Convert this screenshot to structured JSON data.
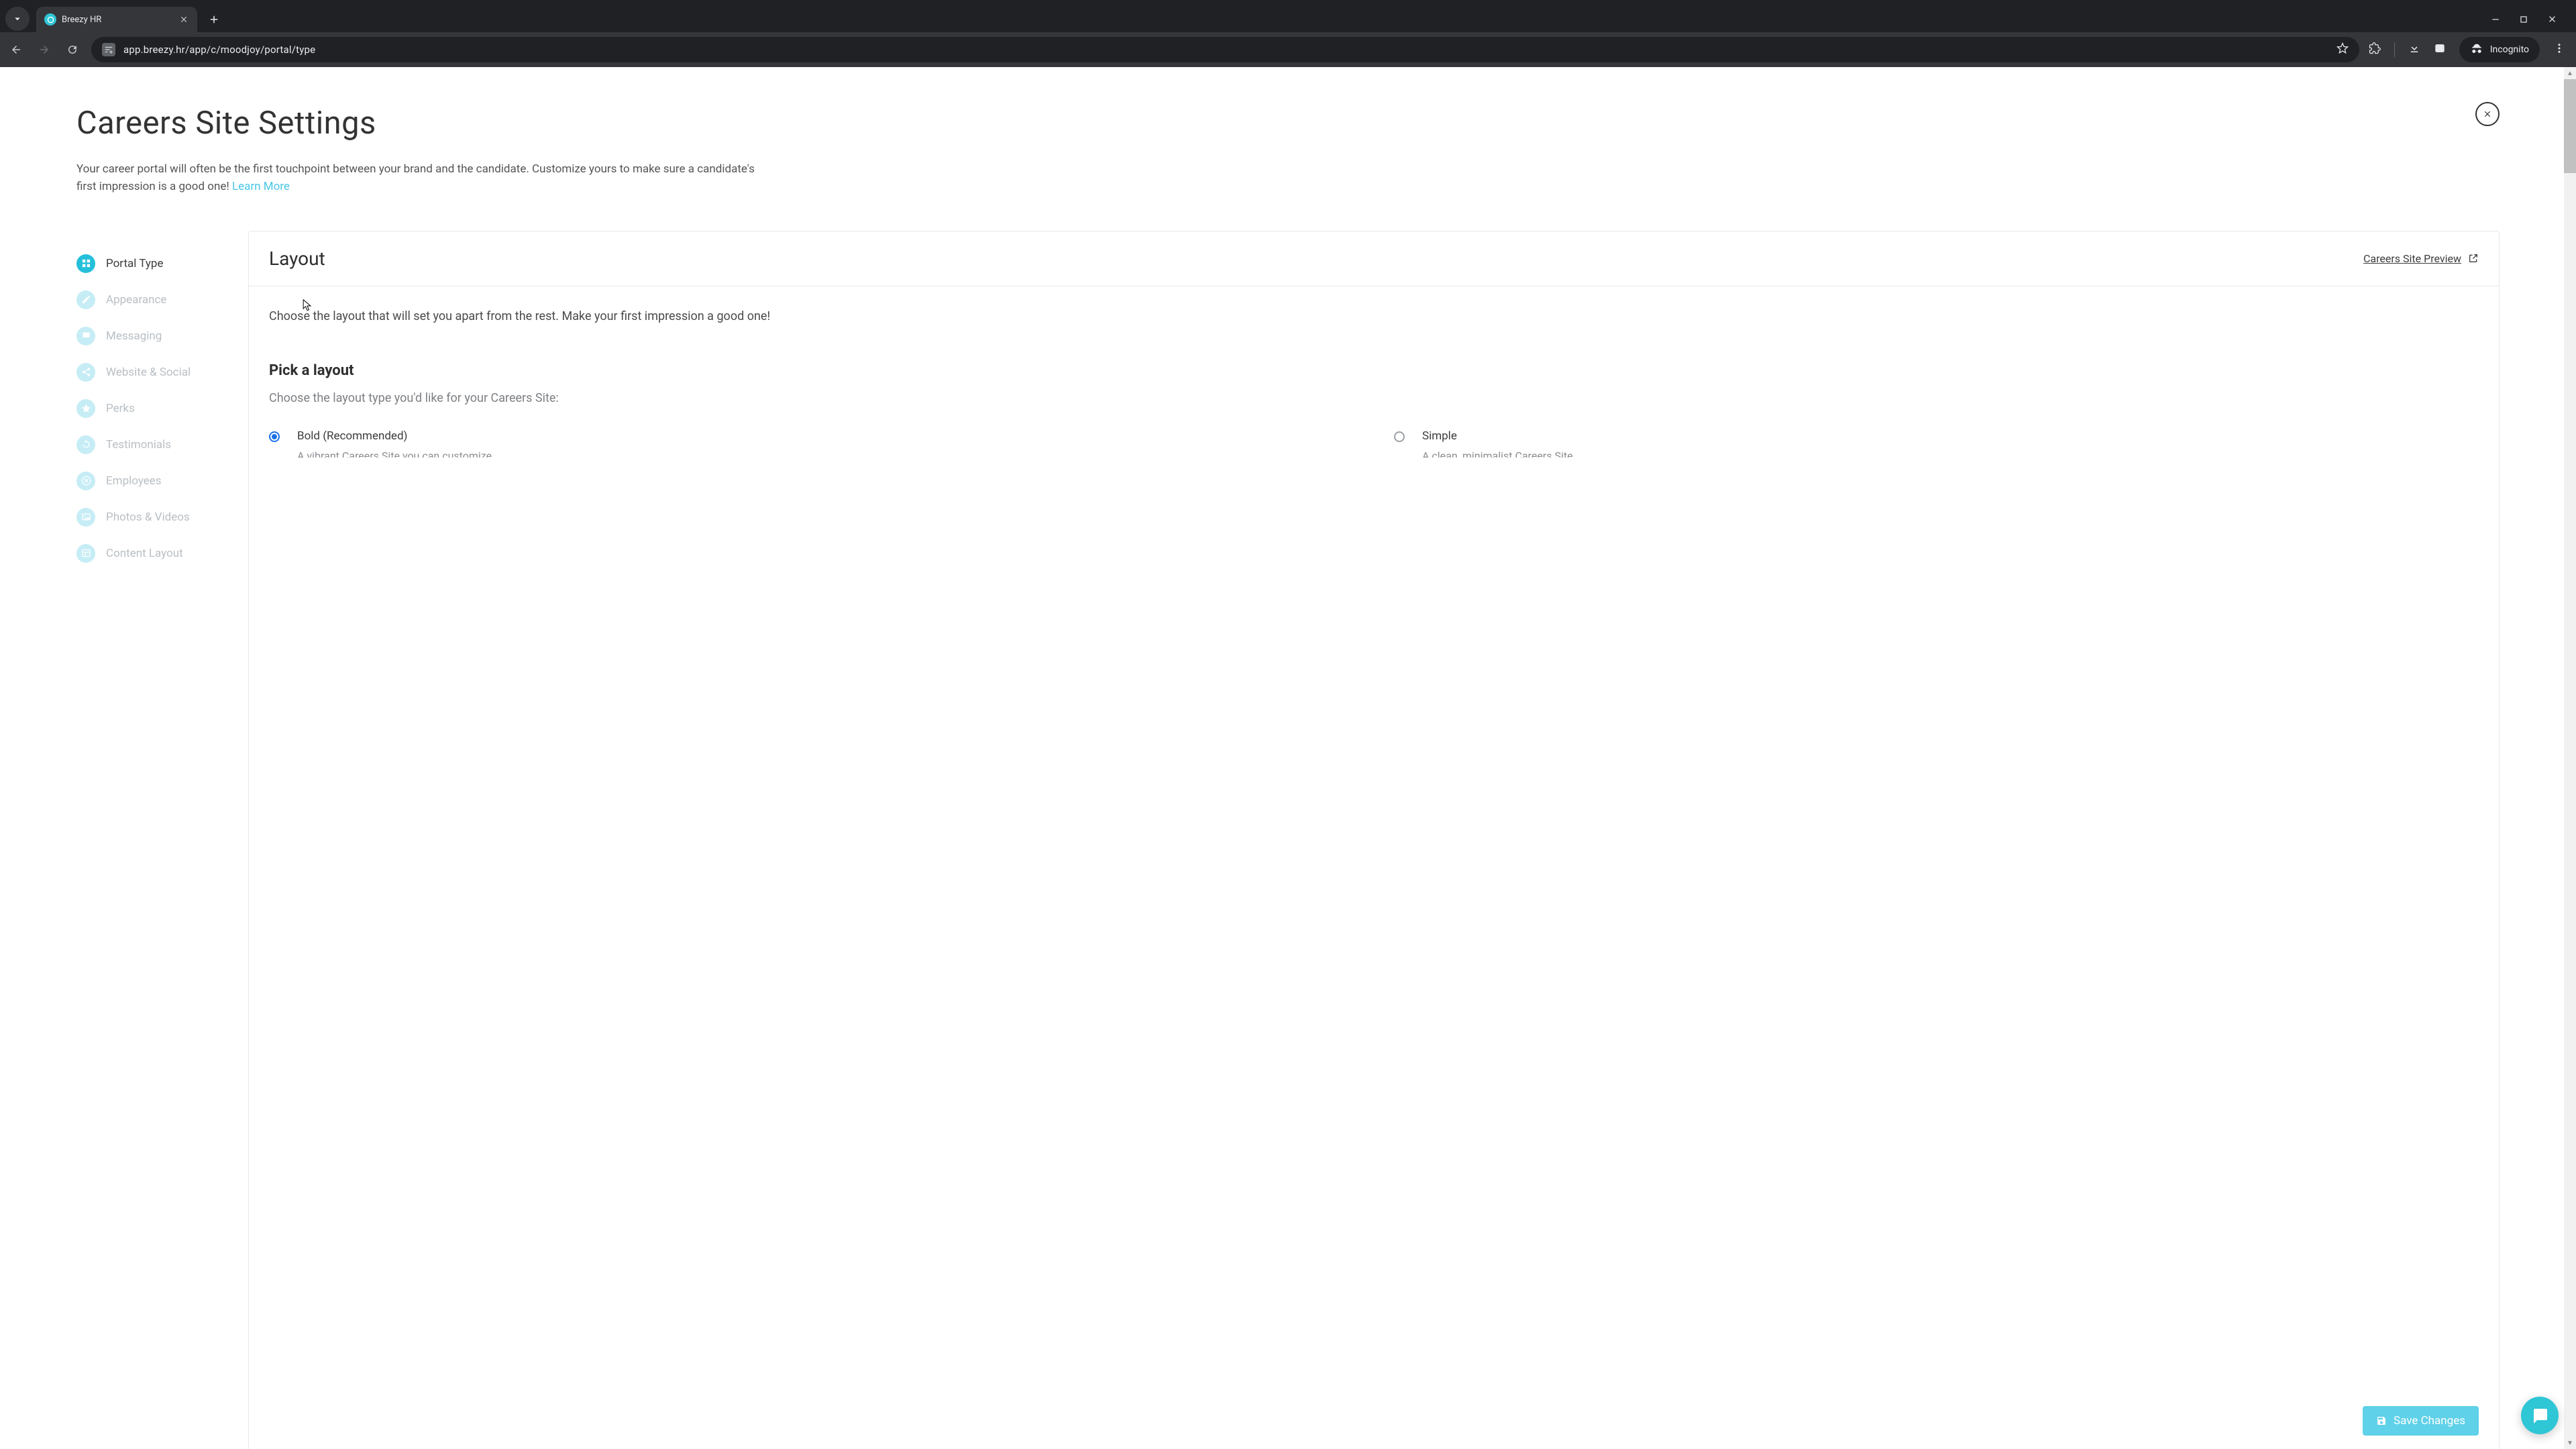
{
  "browser": {
    "tab_title": "Breezy HR",
    "url": "app.breezy.hr/app/c/moodjoy/portal/type",
    "incognito_label": "Incognito"
  },
  "page": {
    "title": "Careers Site Settings",
    "description": "Your career portal will often be the first touchpoint between your brand and the candidate. Customize yours to make sure a candidate's first impression is a good one! ",
    "learn_more": "Learn More"
  },
  "sidebar": {
    "items": [
      {
        "label": "Portal Type",
        "icon": "grid",
        "active": true
      },
      {
        "label": "Appearance",
        "icon": "pencil",
        "active": false
      },
      {
        "label": "Messaging",
        "icon": "message",
        "active": false
      },
      {
        "label": "Website & Social",
        "icon": "share",
        "active": false
      },
      {
        "label": "Perks",
        "icon": "star",
        "active": false
      },
      {
        "label": "Testimonials",
        "icon": "refresh",
        "active": false
      },
      {
        "label": "Employees",
        "icon": "close-circle",
        "active": false
      },
      {
        "label": "Photos & Videos",
        "icon": "image",
        "active": false
      },
      {
        "label": "Content Layout",
        "icon": "layout",
        "active": false
      }
    ]
  },
  "panel": {
    "header_title": "Layout",
    "preview_link": "Careers Site Preview",
    "lead": "Choose the layout that will set you apart from the rest. Make your first impression a good one!",
    "sub_title": "Pick a layout",
    "sub_desc": "Choose the layout type you'd like for your Careers Site:",
    "options": [
      {
        "label": "Bold (Recommended)",
        "desc": "A vibrant Careers Site you can customize",
        "checked": true
      },
      {
        "label": "Simple",
        "desc": "A clean, minimalist Careers Site",
        "checked": false
      }
    ],
    "save_label": "Save Changes"
  }
}
